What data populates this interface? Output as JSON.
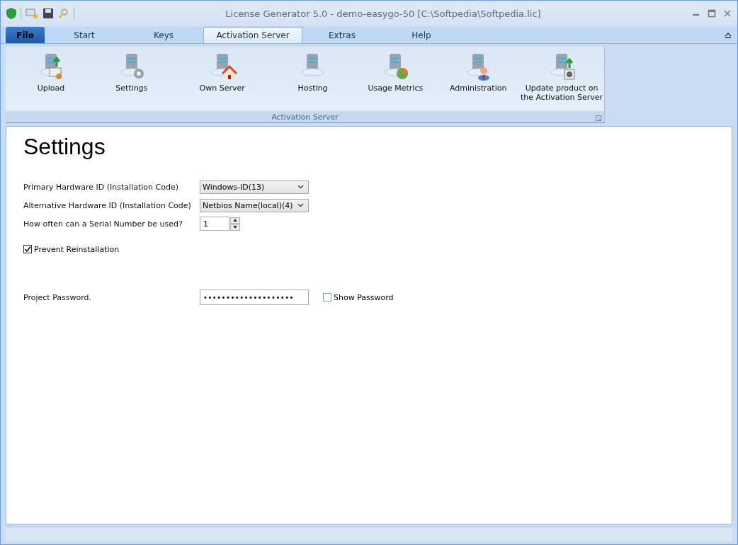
{
  "window": {
    "title": "License Generator 5.0  - demo-easygo-50 [C:\\Softpedia\\Softpedia.lic]"
  },
  "tabs": [
    {
      "label": "File",
      "kind": "file",
      "selected": false
    },
    {
      "label": "Start",
      "kind": "tab",
      "selected": false
    },
    {
      "label": "Keys",
      "kind": "tab",
      "selected": false
    },
    {
      "label": "Activation Server",
      "kind": "tab",
      "selected": true
    },
    {
      "label": "Extras",
      "kind": "tab",
      "selected": false
    },
    {
      "label": "Help",
      "kind": "tab",
      "selected": false
    }
  ],
  "ribbon": {
    "group_label": "Activation Server",
    "buttons": [
      {
        "label": "Upload",
        "kind": "upload"
      },
      {
        "label": "Settings",
        "kind": "gear"
      },
      {
        "label": "Own Server",
        "kind": "house"
      },
      {
        "label": "Hosting",
        "kind": "plain"
      },
      {
        "label": "Usage Metrics",
        "kind": "pie"
      },
      {
        "label": "Administration",
        "kind": "person"
      },
      {
        "label": "Update product on the Activation Server",
        "kind": "update"
      }
    ]
  },
  "page": {
    "heading": "Settings",
    "fields": [
      {
        "kind": "select",
        "label": "Primary Hardware ID (Installation Code)",
        "value": "Windows-ID(13)"
      },
      {
        "kind": "select",
        "label": "Alternative Hardware ID (Installation Code)",
        "value": "Netbios Name(local)(4)"
      },
      {
        "kind": "spin",
        "label": "How often can a Serial Number be used?",
        "value": "1"
      }
    ],
    "prevent_reinstallation": {
      "label": "Prevent Reinstallation",
      "checked": true
    },
    "password": {
      "label": "Project Password.",
      "value": "••••••••••••••••••••",
      "show_label": "Show Password",
      "show_checked": false
    }
  }
}
